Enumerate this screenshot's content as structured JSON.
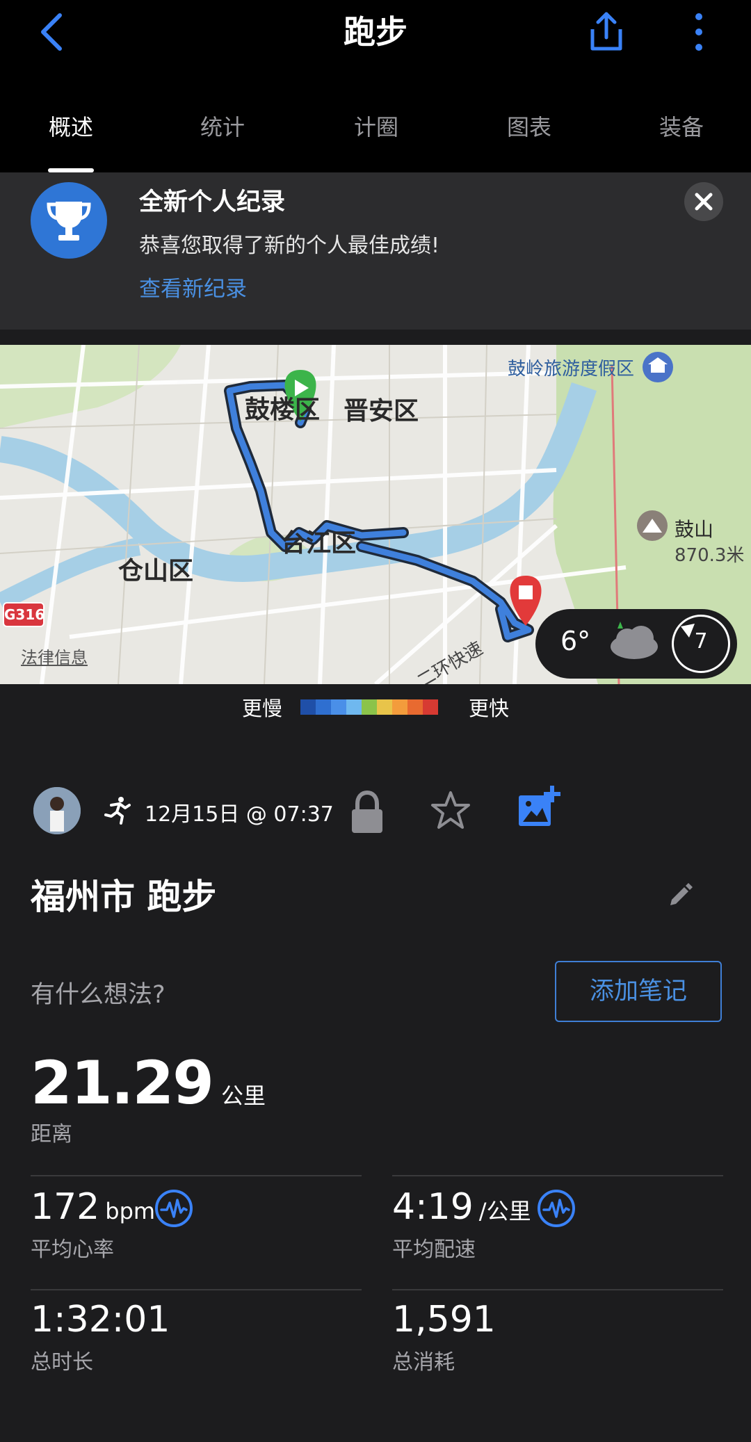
{
  "header": {
    "title": "跑步"
  },
  "tabs": [
    "概述",
    "统计",
    "计圈",
    "图表",
    "装备"
  ],
  "banner": {
    "title": "全新个人纪录",
    "message": "恭喜您取得了新的个人最佳成绩!",
    "link": "查看新纪录"
  },
  "map": {
    "labels": {
      "gulou": "鼓楼区",
      "jinan": "晋安区",
      "taijiang": "台江区",
      "cangshan": "仓山区",
      "guling": "鼓岭旅游度假区",
      "gushan": "鼓山",
      "gushan_elev": "870.3米",
      "ring": "二环快速",
      "g316": "G316",
      "legal": "法律信息"
    },
    "weather": {
      "temp": "6°",
      "wind": "7"
    }
  },
  "legend": {
    "slow": "更慢",
    "fast": "更快",
    "colors": [
      "#1f4fa8",
      "#2f6fd0",
      "#4a8fe8",
      "#6fb8ef",
      "#8bc34a",
      "#e8c44a",
      "#f39c3c",
      "#e86a30",
      "#d73a32"
    ]
  },
  "activity": {
    "date": "12月15日 @ 07:37",
    "title": "福州市 跑步",
    "thought_placeholder": "有什么想法?",
    "add_note": "添加笔记"
  },
  "distance": {
    "value": "21.29",
    "unit": "公里",
    "label": "距离"
  },
  "stats": {
    "hr": {
      "value": "172",
      "unit": "bpm",
      "label": "平均心率"
    },
    "pace": {
      "value": "4:19",
      "unit": "/公里",
      "label": "平均配速"
    },
    "duration": {
      "value": "1:32:01",
      "label": "总时长"
    },
    "calories": {
      "value": "1,591",
      "label": "总消耗"
    }
  }
}
